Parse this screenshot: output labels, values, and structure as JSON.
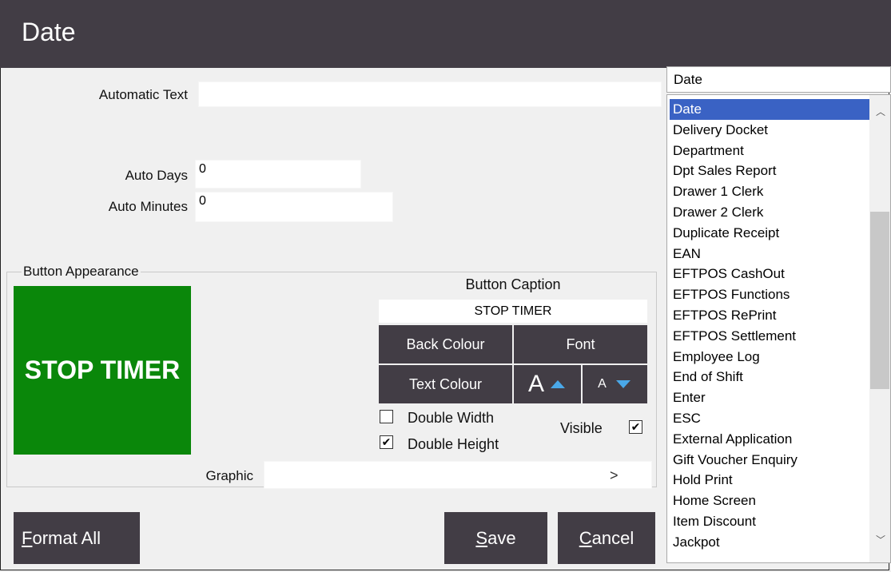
{
  "window": {
    "title": "Date"
  },
  "fields": {
    "automatic_text_label": "Automatic Text",
    "automatic_text_value": "",
    "auto_days_label": "Auto Days",
    "auto_days_value": "0",
    "auto_minutes_label": "Auto Minutes",
    "auto_minutes_value": "0"
  },
  "appearance": {
    "group_title": "Button Appearance",
    "preview_text": "STOP TIMER",
    "preview_color": "#0a870a",
    "caption_title": "Button Caption",
    "caption_value": "STOP TIMER",
    "back_colour_label": "Back Colour",
    "font_label": "Font",
    "text_colour_label": "Text Colour",
    "font_increase_glyph": "A",
    "font_decrease_glyph": "A",
    "double_width_label": "Double Width",
    "double_width_checked": false,
    "double_height_label": "Double Height",
    "double_height_checked": true,
    "visible_label": "Visible",
    "visible_checked": true,
    "graphic_label": "Graphic",
    "graphic_value": "",
    "graphic_browse": ">"
  },
  "buttons": {
    "format_all_first": "F",
    "format_all_rest": "ormat All",
    "save_first": "S",
    "save_rest": "ave",
    "cancel_first": "C",
    "cancel_rest": "ancel"
  },
  "list": {
    "search_value": "Date",
    "items": [
      "Date",
      "Delivery Docket",
      "Department",
      "Dpt Sales Report",
      "Drawer 1 Clerk",
      "Drawer 2 Clerk",
      "Duplicate Receipt",
      "EAN",
      "EFTPOS CashOut",
      "EFTPOS Functions",
      "EFTPOS RePrint",
      "EFTPOS Settlement",
      "Employee Log",
      "End of Shift",
      "Enter",
      "ESC",
      "External Application",
      "Gift Voucher Enquiry",
      "Hold Print",
      "Home Screen",
      "Item Discount",
      "Jackpot"
    ],
    "selected_index": 0
  },
  "colors": {
    "titlebar": "#423d45",
    "accent_button": "#423d45",
    "selection": "#3a62c4",
    "arrow_blue": "#4aa8e8"
  }
}
